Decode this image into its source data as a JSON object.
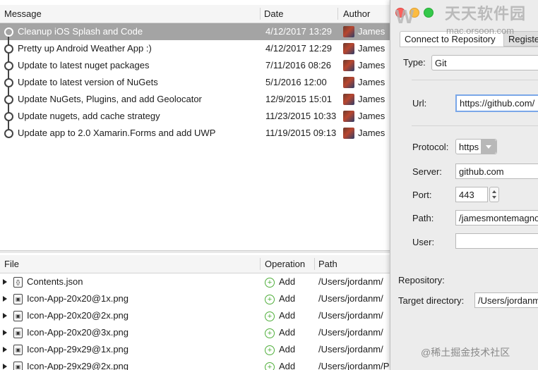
{
  "history": {
    "columns": {
      "message": "Message",
      "date": "Date",
      "author": "Author"
    },
    "commits": [
      {
        "message": "Cleanup iOS Splash and Code",
        "date": "4/12/2017 13:29",
        "author": "James",
        "selected": true
      },
      {
        "message": "Pretty up Android Weather App :)",
        "date": "4/12/2017 12:29",
        "author": "James"
      },
      {
        "message": "Update to latest nuget packages",
        "date": "7/11/2016 08:26",
        "author": "James"
      },
      {
        "message": "Update to latest version of NuGets",
        "date": "5/1/2016 12:00",
        "author": "James"
      },
      {
        "message": "Update NuGets, Plugins, and add Geolocator",
        "date": "12/9/2015 15:01",
        "author": "James"
      },
      {
        "message": "Update nugets, add cache strategy",
        "date": "11/23/2015 10:33",
        "author": "James"
      },
      {
        "message": "Update app to 2.0 Xamarin.Forms and add UWP",
        "date": "11/19/2015 09:13",
        "author": "James"
      }
    ]
  },
  "files": {
    "columns": {
      "file": "File",
      "operation": "Operation",
      "path": "Path"
    },
    "items": [
      {
        "name": "Contents.json",
        "icon": "json-file-icon",
        "icon_glyph": "{}",
        "operation": "Add",
        "path": "/Users/jordanm/"
      },
      {
        "name": "Icon-App-20x20@1x.png",
        "icon": "image-file-icon",
        "icon_glyph": "▣",
        "operation": "Add",
        "path": "/Users/jordanm/"
      },
      {
        "name": "Icon-App-20x20@2x.png",
        "icon": "image-file-icon",
        "icon_glyph": "▣",
        "operation": "Add",
        "path": "/Users/jordanm/"
      },
      {
        "name": "Icon-App-20x20@3x.png",
        "icon": "image-file-icon",
        "icon_glyph": "▣",
        "operation": "Add",
        "path": "/Users/jordanm/"
      },
      {
        "name": "Icon-App-29x29@1x.png",
        "icon": "image-file-icon",
        "icon_glyph": "▣",
        "operation": "Add",
        "path": "/Users/jordanm/"
      },
      {
        "name": "Icon-App-29x29@2x.png",
        "icon": "image-file-icon",
        "icon_glyph": "▣",
        "operation": "Add",
        "path": "/Users/jordanm/Projects/JamesMontemagno/Weather"
      }
    ]
  },
  "dialog": {
    "tabs": {
      "connect": "Connect to Repository",
      "register": "Registe"
    },
    "type_label": "Type:",
    "type_value": "Git",
    "url_label": "Url:",
    "url_value": "https://github.com/",
    "protocol_label": "Protocol:",
    "protocol_value": "https",
    "server_label": "Server:",
    "server_value": "github.com",
    "port_label": "Port:",
    "port_value": "443",
    "path_label": "Path:",
    "path_value": "/jamesmontemagno",
    "user_label": "User:",
    "user_value": "",
    "repository_label": "Repository:",
    "target_label": "Target directory:",
    "target_value": "/Users/jordanm",
    "colors": {
      "close": "#fc605c",
      "minimize": "#fdbc40",
      "zoom": "#34c84a",
      "focus_ring": "#7aa7e8"
    }
  },
  "watermarks": {
    "site_title": "天天软件园",
    "site_url": "mac.orsoon.com",
    "juejin": "@稀土掘金技术社区"
  }
}
